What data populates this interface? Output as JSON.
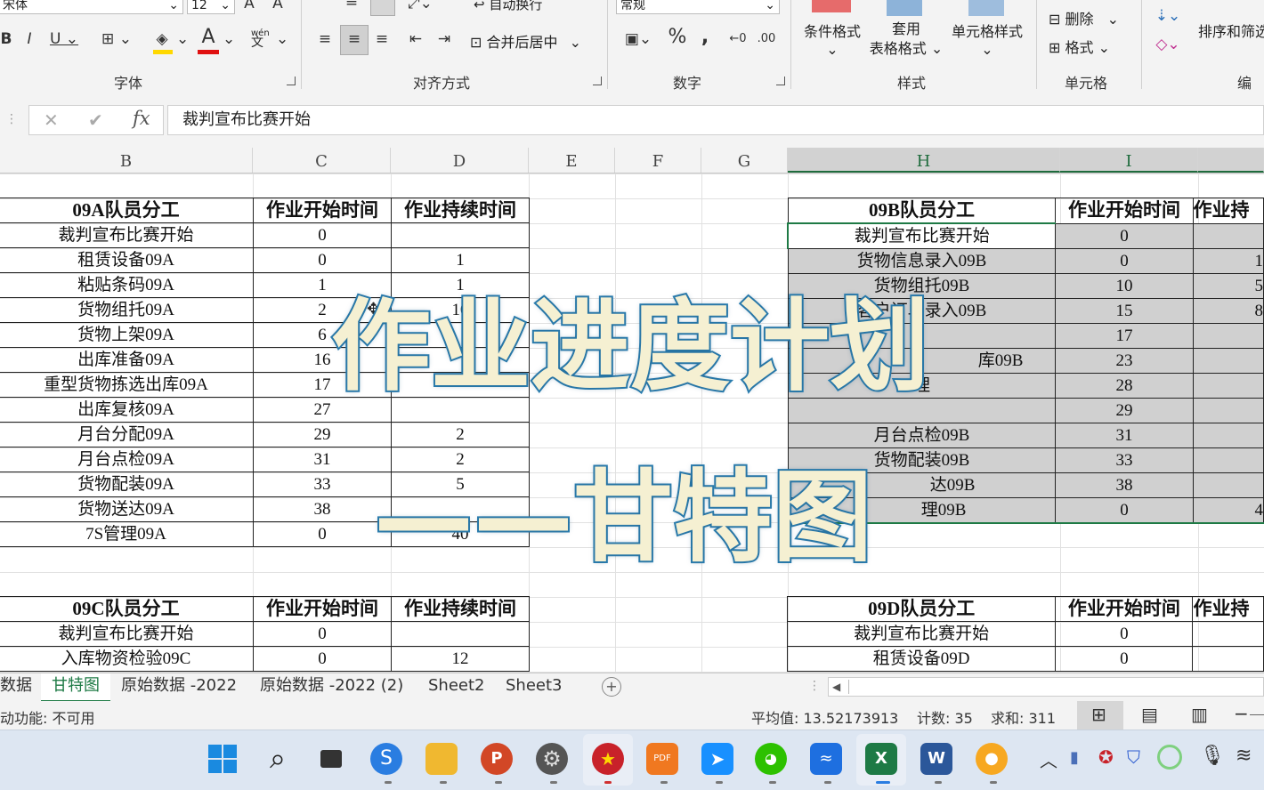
{
  "ribbon": {
    "font_name": "宋体",
    "font_size": "12",
    "wrap_text": "自动换行",
    "merge_center": "合并后居中",
    "number_format": "常规",
    "conditional_format": "条件格式",
    "table_format_l1": "套用",
    "table_format_l2": "表格格式",
    "cell_style": "单元格样式",
    "delete": "删除",
    "format": "格式",
    "sort_filter": "排序和筛选",
    "pinyin": "wén",
    "groups": {
      "font": "字体",
      "align": "对齐方式",
      "number": "数字",
      "styles": "样式",
      "cells": "单元格",
      "edit": "编辑"
    }
  },
  "formula_bar": {
    "content": "裁判宣布比赛开始"
  },
  "columns": [
    "B",
    "C",
    "D",
    "E",
    "F",
    "G",
    "H",
    "I"
  ],
  "table_a": {
    "header": [
      "09A队员分工",
      "作业开始时间",
      "作业持续时间"
    ],
    "rows": [
      [
        "裁判宣布比赛开始",
        "0",
        ""
      ],
      [
        "租赁设备09A",
        "0",
        "1"
      ],
      [
        "粘贴条码09A",
        "1",
        "1"
      ],
      [
        "货物组托09A",
        "2",
        "10"
      ],
      [
        "货物上架09A",
        "6",
        ""
      ],
      [
        "出库准备09A",
        "16",
        ""
      ],
      [
        "重型货物拣选出库09A",
        "17",
        ""
      ],
      [
        "出库复核09A",
        "27",
        ""
      ],
      [
        "月台分配09A",
        "29",
        "2"
      ],
      [
        "月台点检09A",
        "31",
        "2"
      ],
      [
        "货物配装09A",
        "33",
        "5"
      ],
      [
        "货物送达09A",
        "38",
        ""
      ],
      [
        "7S管理09A",
        "0",
        "40"
      ]
    ]
  },
  "table_b": {
    "header": [
      "09B队员分工",
      "作业开始时间",
      "作业持"
    ],
    "rows": [
      [
        "裁判宣布比赛开始",
        "0",
        ""
      ],
      [
        "货物信息录入09B",
        "0",
        "1"
      ],
      [
        "货物组托09B",
        "10",
        "5"
      ],
      [
        "客户订单录入09B",
        "15",
        "8"
      ],
      [
        "",
        "17",
        ""
      ],
      [
        "库09B",
        "23",
        ""
      ],
      [
        "理",
        "28",
        ""
      ],
      [
        "",
        "29",
        ""
      ],
      [
        "月台点检09B",
        "31",
        ""
      ],
      [
        "货物配装09B",
        "33",
        ""
      ],
      [
        "达09B",
        "38",
        ""
      ],
      [
        "理09B",
        "0",
        "4"
      ]
    ]
  },
  "table_c": {
    "header": [
      "09C队员分工",
      "作业开始时间",
      "作业持续时间"
    ],
    "rows": [
      [
        "裁判宣布比赛开始",
        "0",
        ""
      ],
      [
        "入库物资检验09C",
        "0",
        "12"
      ]
    ]
  },
  "table_d": {
    "header": [
      "09D队员分工",
      "作业开始时间",
      "作业持"
    ],
    "rows": [
      [
        "裁判宣布比赛开始",
        "0",
        ""
      ],
      [
        "租赁设备09D",
        "0",
        ""
      ]
    ]
  },
  "overlay": {
    "line1": "作业进度计划",
    "line2": "——甘特图"
  },
  "sheet_tabs": [
    "数据",
    "甘特图",
    "原始数据 -2022",
    "原始数据 -2022 (2)",
    "Sheet2",
    "Sheet3"
  ],
  "active_tab": "甘特图",
  "status": {
    "accessibility": "动功能: 不可用",
    "average": "平均值: 13.52173913",
    "count": "计数: 35",
    "sum": "求和: 311"
  },
  "colors": {
    "excel_green": "#1e7a45",
    "overlay_fill": "#f5f0d2",
    "overlay_stroke": "#2b7eb0"
  }
}
